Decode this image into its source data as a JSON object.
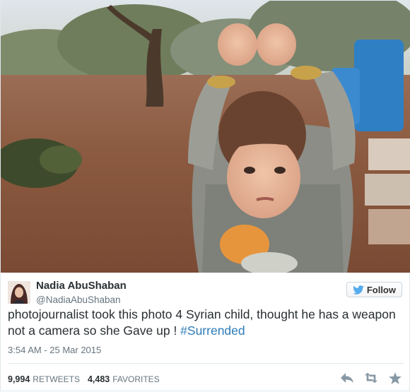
{
  "tweet": {
    "author_name": "Nadia AbuShaban",
    "author_handle": "@NadiaAbuShaban",
    "follow_label": "Follow",
    "text_main": "photojournalist took this photo 4 Syrian child, thought he has a weapon not a camera so she Gave up ! ",
    "hashtag": "#Surrended",
    "timestamp": "3:54 AM - 25 Mar 2015",
    "retweets_count": "9,994",
    "retweets_label": "RETWEETS",
    "favorites_count": "4,483",
    "favorites_label": "FAVORITES"
  },
  "icons": {
    "twitter_bird": "twitter-bird-icon",
    "reply": "reply-icon",
    "retweet": "retweet-icon",
    "favorite": "favorite-icon"
  },
  "colors": {
    "accent": "#2b7bb9",
    "bird": "#55acee",
    "muted": "#66757f",
    "text": "#292f33",
    "action_icon": "#8899a6"
  }
}
